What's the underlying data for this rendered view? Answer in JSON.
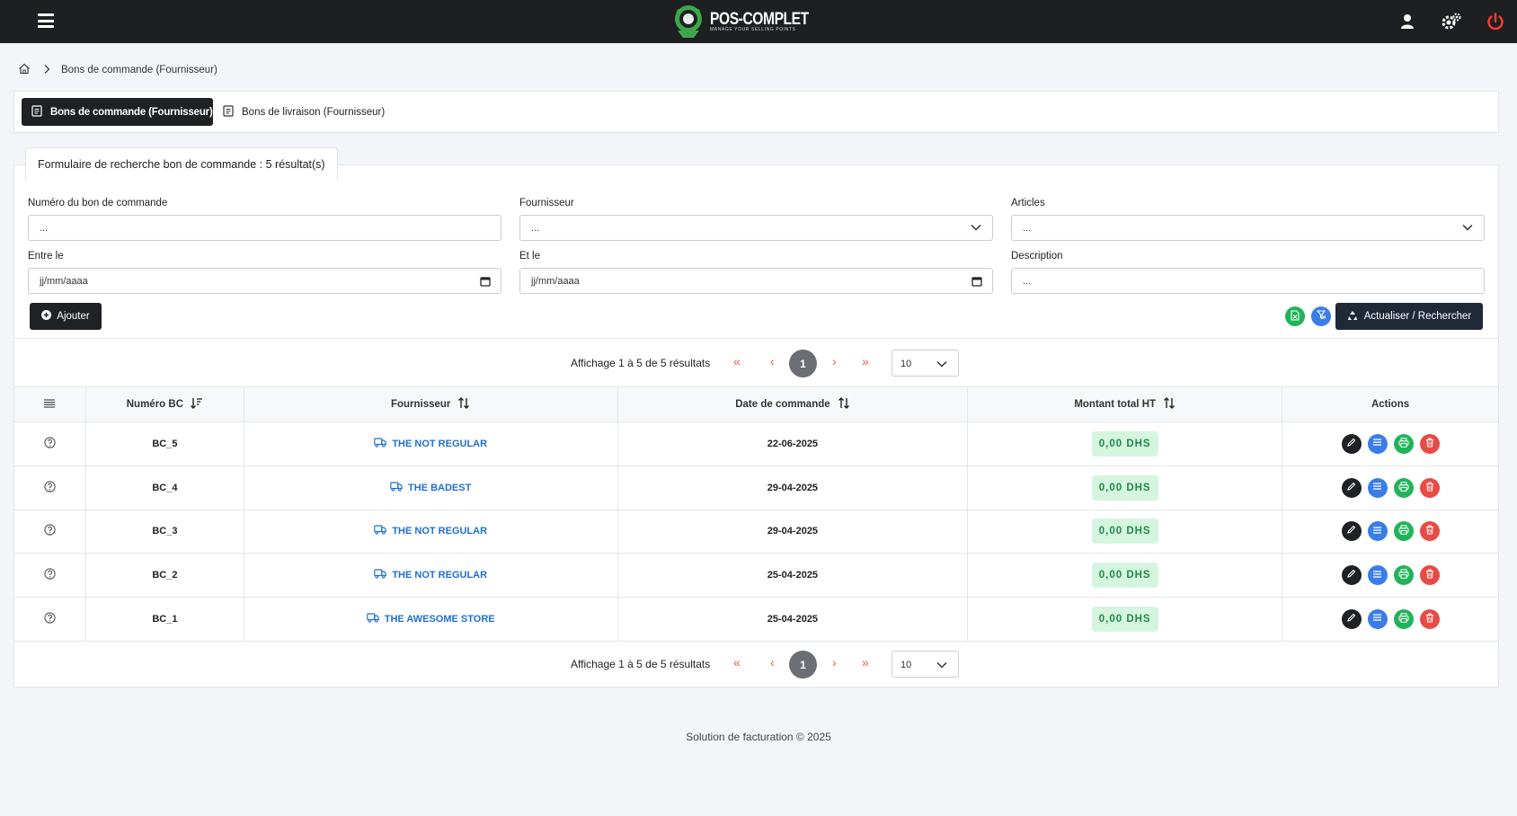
{
  "app": {
    "logo_title": "POS-COMPLET",
    "logo_subtitle": "MANAGE YOUR SELLING POINTS"
  },
  "breadcrumb": {
    "current": "Bons de commande (Fournisseur)"
  },
  "tabs": [
    {
      "label": "Bons de commande (Fournisseur)",
      "active": true
    },
    {
      "label": "Bons de livraison (Fournisseur)",
      "active": false
    }
  ],
  "search_form": {
    "legend": "Formulaire de recherche bon de commande : 5 résultat(s)",
    "fields": {
      "numero": {
        "label": "Numéro du bon de commande",
        "value": "..."
      },
      "fournisseur": {
        "label": "Fournisseur",
        "value": "..."
      },
      "articles": {
        "label": "Articles",
        "value": "..."
      },
      "entre_le": {
        "label": "Entre le",
        "value": "jj/mm/aaaa"
      },
      "et_le": {
        "label": "Et le",
        "value": "jj/mm/aaaa"
      },
      "description": {
        "label": "Description",
        "value": "..."
      }
    },
    "add_label": "Ajouter",
    "refresh_label": "Actualiser / Rechercher"
  },
  "pagination": {
    "info": "Affichage 1 à 5 de 5 résultats",
    "first": "«",
    "prev": "‹",
    "current": "1",
    "next": "›",
    "last": "»",
    "per_page": "10"
  },
  "table": {
    "headers": [
      "Numéro BC",
      "Fournisseur",
      "Date de commande",
      "Montant total HT",
      "Actions"
    ],
    "rows": [
      {
        "numero": "BC_5",
        "fournisseur": "THE NOT REGULAR",
        "date": "22-06-2025",
        "montant": "0,00 DHS"
      },
      {
        "numero": "BC_4",
        "fournisseur": "THE BADEST",
        "date": "29-04-2025",
        "montant": "0,00 DHS"
      },
      {
        "numero": "BC_3",
        "fournisseur": "THE NOT REGULAR",
        "date": "29-04-2025",
        "montant": "0,00 DHS"
      },
      {
        "numero": "BC_2",
        "fournisseur": "THE NOT REGULAR",
        "date": "25-04-2025",
        "montant": "0,00 DHS"
      },
      {
        "numero": "BC_1",
        "fournisseur": "THE AWESOME STORE",
        "date": "25-04-2025",
        "montant": "0,00 DHS"
      }
    ]
  },
  "footer": {
    "text": "Solution de facturation © 2025"
  },
  "colors": {
    "topbar": "#1e1f21",
    "accent_green": "#22b35a",
    "accent_blue": "#3b7de8",
    "danger": "#e84a45",
    "link": "#1f6fd1"
  }
}
